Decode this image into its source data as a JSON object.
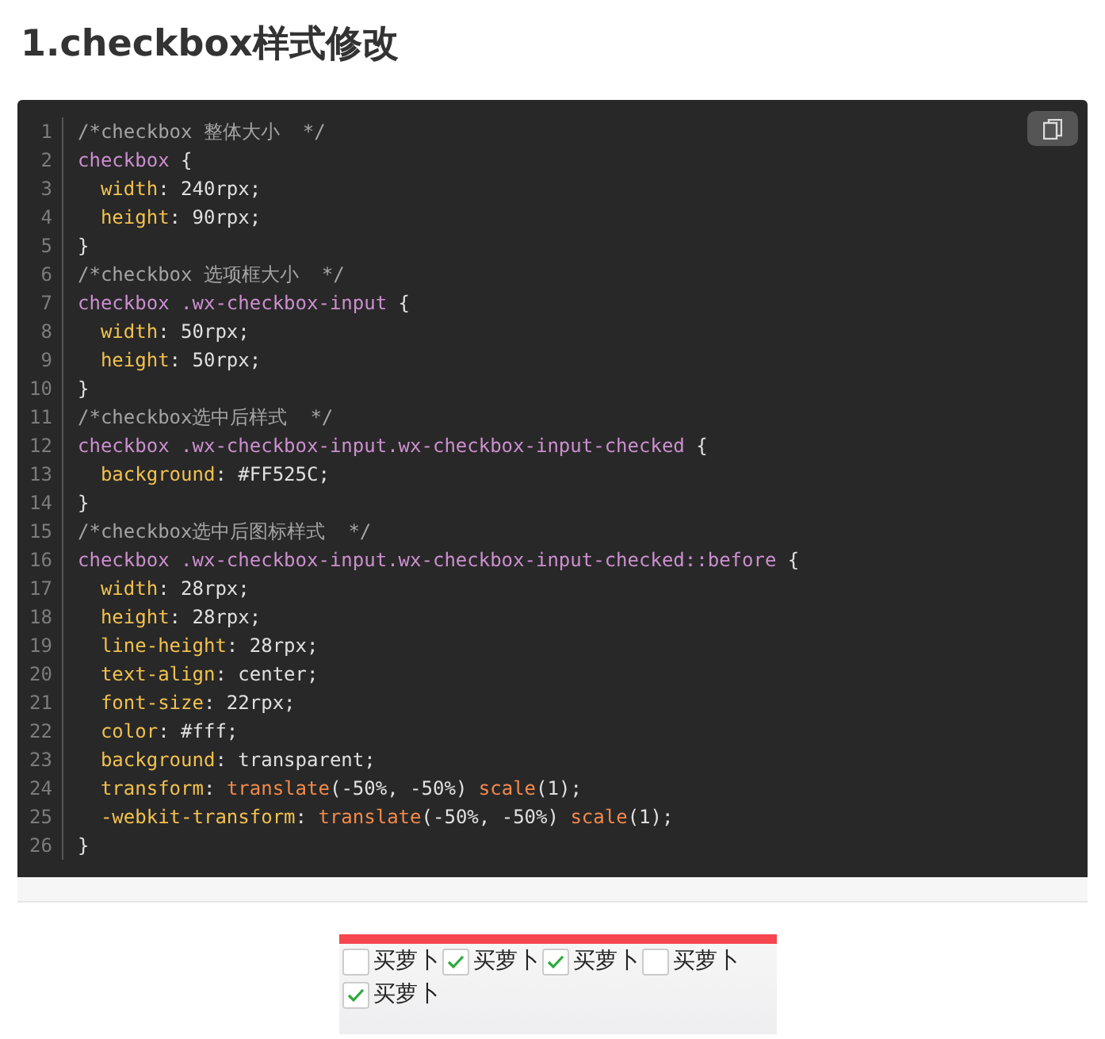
{
  "heading": "1.checkbox样式修改",
  "code": {
    "lines": [
      {
        "number": "1",
        "tokens": [
          {
            "kind": "comment",
            "text": "/*checkbox 整体大小  */"
          }
        ]
      },
      {
        "number": "2",
        "tokens": [
          {
            "kind": "selector",
            "text": "checkbox"
          },
          {
            "kind": "plain",
            "text": " {"
          }
        ]
      },
      {
        "number": "3",
        "tokens": [
          {
            "kind": "property",
            "text": "  width"
          },
          {
            "kind": "plain",
            "text": ": 240rpx;"
          }
        ]
      },
      {
        "number": "4",
        "tokens": [
          {
            "kind": "property",
            "text": "  height"
          },
          {
            "kind": "plain",
            "text": ": 90rpx;"
          }
        ]
      },
      {
        "number": "5",
        "tokens": [
          {
            "kind": "plain",
            "text": "}"
          }
        ]
      },
      {
        "number": "6",
        "tokens": [
          {
            "kind": "comment",
            "text": "/*checkbox 选项框大小  */"
          }
        ]
      },
      {
        "number": "7",
        "tokens": [
          {
            "kind": "selector",
            "text": "checkbox .wx-checkbox-input"
          },
          {
            "kind": "plain",
            "text": " {"
          }
        ]
      },
      {
        "number": "8",
        "tokens": [
          {
            "kind": "property",
            "text": "  width"
          },
          {
            "kind": "plain",
            "text": ": 50rpx;"
          }
        ]
      },
      {
        "number": "9",
        "tokens": [
          {
            "kind": "property",
            "text": "  height"
          },
          {
            "kind": "plain",
            "text": ": 50rpx;"
          }
        ]
      },
      {
        "number": "10",
        "tokens": [
          {
            "kind": "plain",
            "text": "}"
          }
        ]
      },
      {
        "number": "11",
        "tokens": [
          {
            "kind": "comment",
            "text": "/*checkbox选中后样式  */"
          }
        ]
      },
      {
        "number": "12",
        "tokens": [
          {
            "kind": "selector",
            "text": "checkbox .wx-checkbox-input.wx-checkbox-input-checked"
          },
          {
            "kind": "plain",
            "text": " {"
          }
        ]
      },
      {
        "number": "13",
        "tokens": [
          {
            "kind": "property",
            "text": "  background"
          },
          {
            "kind": "plain",
            "text": ": #FF525C;"
          }
        ]
      },
      {
        "number": "14",
        "tokens": [
          {
            "kind": "plain",
            "text": "}"
          }
        ]
      },
      {
        "number": "15",
        "tokens": [
          {
            "kind": "comment",
            "text": "/*checkbox选中后图标样式  */"
          }
        ]
      },
      {
        "number": "16",
        "tokens": [
          {
            "kind": "selector",
            "text": "checkbox .wx-checkbox-input.wx-checkbox-input-checked::before"
          },
          {
            "kind": "plain",
            "text": " {"
          }
        ]
      },
      {
        "number": "17",
        "tokens": [
          {
            "kind": "property",
            "text": "  width"
          },
          {
            "kind": "plain",
            "text": ": 28rpx;"
          }
        ]
      },
      {
        "number": "18",
        "tokens": [
          {
            "kind": "property",
            "text": "  height"
          },
          {
            "kind": "plain",
            "text": ": 28rpx;"
          }
        ]
      },
      {
        "number": "19",
        "tokens": [
          {
            "kind": "property",
            "text": "  line-height"
          },
          {
            "kind": "plain",
            "text": ": 28rpx;"
          }
        ]
      },
      {
        "number": "20",
        "tokens": [
          {
            "kind": "property",
            "text": "  text-align"
          },
          {
            "kind": "plain",
            "text": ": center;"
          }
        ]
      },
      {
        "number": "21",
        "tokens": [
          {
            "kind": "property",
            "text": "  font-size"
          },
          {
            "kind": "plain",
            "text": ": 22rpx;"
          }
        ]
      },
      {
        "number": "22",
        "tokens": [
          {
            "kind": "property",
            "text": "  color"
          },
          {
            "kind": "plain",
            "text": ": #fff;"
          }
        ]
      },
      {
        "number": "23",
        "tokens": [
          {
            "kind": "property",
            "text": "  background"
          },
          {
            "kind": "plain",
            "text": ": transparent;"
          }
        ]
      },
      {
        "number": "24",
        "tokens": [
          {
            "kind": "property",
            "text": "  transform"
          },
          {
            "kind": "plain",
            "text": ": "
          },
          {
            "kind": "function",
            "text": "translate"
          },
          {
            "kind": "plain",
            "text": "(-50%, -50%) "
          },
          {
            "kind": "function",
            "text": "scale"
          },
          {
            "kind": "plain",
            "text": "(1);"
          }
        ]
      },
      {
        "number": "25",
        "tokens": [
          {
            "kind": "property",
            "text": "  -webkit-transform"
          },
          {
            "kind": "plain",
            "text": ": "
          },
          {
            "kind": "function",
            "text": "translate"
          },
          {
            "kind": "plain",
            "text": "(-50%, -50%) "
          },
          {
            "kind": "function",
            "text": "scale"
          },
          {
            "kind": "plain",
            "text": "(1);"
          }
        ]
      },
      {
        "number": "26",
        "tokens": [
          {
            "kind": "plain",
            "text": "}"
          }
        ]
      }
    ]
  },
  "preview": {
    "checkboxes": [
      {
        "label": "买萝卜",
        "checked": false
      },
      {
        "label": "买萝卜",
        "checked": true
      },
      {
        "label": "买萝卜",
        "checked": true
      },
      {
        "label": "买萝卜",
        "checked": false
      },
      {
        "label": "买萝卜",
        "checked": true
      }
    ]
  }
}
